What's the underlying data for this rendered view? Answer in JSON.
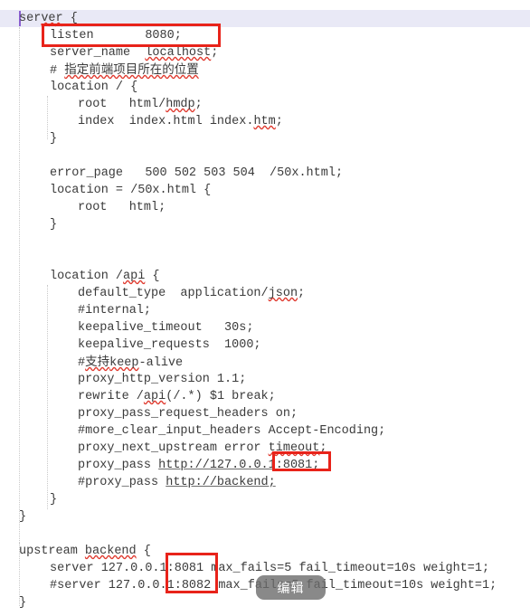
{
  "editor": {
    "language": "nginx",
    "current_line_index": 0,
    "caret_line": "server {",
    "colors": {
      "background": "#ffffff",
      "text": "#3b3b3b",
      "current_line_highlight": "#e9e9f6",
      "caret": "#8a5fd0",
      "annotation_red": "#e8231a",
      "spellcheck_underline": "#e03a2f",
      "indent_guide": "#c9c9c9",
      "chip_background": "#6c6c6c",
      "chip_text": "#ffffff"
    },
    "lines": [
      {
        "indent": 0,
        "text": "server {"
      },
      {
        "indent": 4,
        "text": "listen        8080;"
      },
      {
        "indent": 4,
        "text": "server_name  localhost;"
      },
      {
        "indent": 4,
        "text": "# 指定前端项目所在的位置"
      },
      {
        "indent": 4,
        "text": "location / {"
      },
      {
        "indent": 8,
        "text": "root   html/hmdp;"
      },
      {
        "indent": 8,
        "text": "index  index.html index.htm;"
      },
      {
        "indent": 4,
        "text": "}"
      },
      {
        "indent": 0,
        "text": ""
      },
      {
        "indent": 4,
        "text": "error_page   500 502 503 504  /50x.html;"
      },
      {
        "indent": 4,
        "text": "location = /50x.html {"
      },
      {
        "indent": 8,
        "text": "root   html;"
      },
      {
        "indent": 4,
        "text": "}"
      },
      {
        "indent": 0,
        "text": ""
      },
      {
        "indent": 0,
        "text": ""
      },
      {
        "indent": 4,
        "text": "location /api {"
      },
      {
        "indent": 8,
        "text": "default_type  application/json;"
      },
      {
        "indent": 8,
        "text": "#internal;"
      },
      {
        "indent": 8,
        "text": "keepalive_timeout   30s;"
      },
      {
        "indent": 8,
        "text": "keepalive_requests  1000;"
      },
      {
        "indent": 8,
        "text": "#支持keep-alive"
      },
      {
        "indent": 8,
        "text": "proxy_http_version 1.1;"
      },
      {
        "indent": 8,
        "text": "rewrite /api(/.*) $1 break;"
      },
      {
        "indent": 8,
        "text": "proxy_pass_request_headers on;"
      },
      {
        "indent": 8,
        "text": "#more_clear_input_headers Accept-Encoding;"
      },
      {
        "indent": 8,
        "text": "proxy_next_upstream error timeout;"
      },
      {
        "indent": 8,
        "text": "proxy_pass http://127.0.0.1:8081;"
      },
      {
        "indent": 8,
        "text": "#proxy_pass http://backend;"
      },
      {
        "indent": 4,
        "text": "}"
      },
      {
        "indent": 0,
        "text": "}"
      },
      {
        "indent": 0,
        "text": ""
      },
      {
        "indent": 0,
        "text": "upstream backend {"
      },
      {
        "indent": 4,
        "text": "server 127.0.0.1:8081 max_fails=5 fail_timeout=10s weight=1;"
      },
      {
        "indent": 4,
        "text": "#server 127.0.0.1:8082 max_fails=5 fail_timeout=10s weight=1;"
      },
      {
        "indent": 0,
        "text": "}"
      }
    ]
  },
  "annotations": [
    {
      "id": "listen-port-box",
      "label": "listen 8080;",
      "highlighted_value": "8080"
    },
    {
      "id": "proxy-pass-port-box",
      "label": "proxy_pass :8081;",
      "highlighted_value": ":8081;"
    },
    {
      "id": "upstream-ports-box",
      "label": "upstream server ports",
      "highlighted_value": "1:8081 / 1:8082"
    }
  ],
  "overlay": {
    "edit_chip_label": "编辑"
  }
}
